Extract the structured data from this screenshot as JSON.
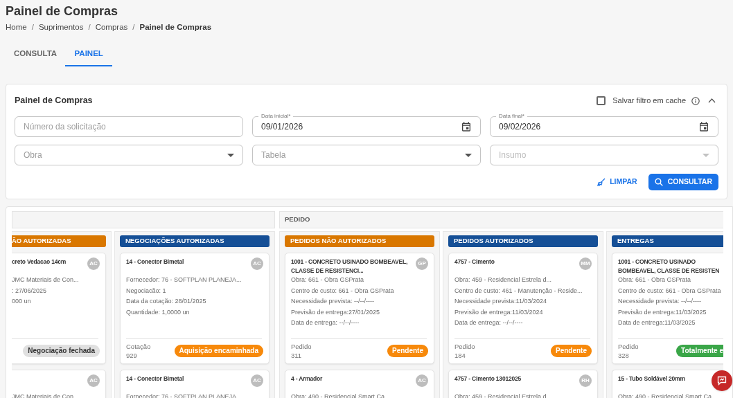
{
  "page": {
    "title": "Painel de Compras",
    "breadcrumbs": [
      "Home",
      "Suprimentos",
      "Compras",
      "Painel de Compras"
    ],
    "separators": [
      "/",
      "/",
      "/"
    ]
  },
  "tabs": [
    {
      "label": "CONSULTA",
      "selected": false
    },
    {
      "label": "PAINEL",
      "selected": true
    }
  ],
  "filter": {
    "title": "Painel de Compras",
    "cache_checkbox": {
      "label": "Salvar filtro em cache",
      "checked": false
    },
    "expanded": true,
    "fields": [
      {
        "kind": "text",
        "placeholder": "Número da solicitação"
      },
      {
        "kind": "date",
        "label": "Data inicial*",
        "value": "09/01/2026"
      },
      {
        "kind": "date",
        "label": "Data final*",
        "value": "09/02/2026"
      },
      {
        "kind": "select",
        "placeholder": "Obra",
        "disabled": false
      },
      {
        "kind": "select",
        "placeholder": "Tabela",
        "disabled": false
      },
      {
        "kind": "select",
        "placeholder": "Insumo",
        "disabled": true
      }
    ],
    "clear_button": "LIMPAR",
    "search_button": "CONSULTAR"
  },
  "board": {
    "groups": [
      {
        "columns": [
          {
            "kind": "cut-left",
            "title": "ÃO AUTORIZADAS",
            "color": "#d97700",
            "cards": [
              {
                "title": "creto Vedacao 14cm",
                "avatar": "AC",
                "lines": [
                  "JMC Materiais de Con...",
                  ": 27/06/2025",
                  "000 un"
                ],
                "status": {
                  "label": "Negociação fechada",
                  "color": "#e0e0e0"
                }
              },
              {
                "avatar": "AC",
                "lines": [
                  "JMC Materiais de Con"
                ]
              }
            ]
          },
          {
            "kind": "full",
            "title": "NEGOCIAÇÕES AUTORIZADAS",
            "color": "#154f96",
            "cards": [
              {
                "title": "14 - Conector Bimetal",
                "avatar": "AC",
                "lines": [
                  "Fornecedor: 76 - SOFTPLAN PLANEJA...",
                  "Negociacão: 1",
                  "Data da cotação: 28/01/2025",
                  "Quantidade: 1,0000 un"
                ],
                "footer_label": "Cotação",
                "footer_value": "929",
                "status": {
                  "label": "Aquisição encaminhada",
                  "color": "#f7890b"
                }
              },
              {
                "title": "14 - Conector Bimetal",
                "avatar": "AC",
                "lines": [
                  "Fornecedor: 76 - SOFTPLAN PLANEJA"
                ]
              }
            ]
          }
        ]
      },
      {
        "title": "PEDIDO",
        "columns": [
          {
            "kind": "full",
            "title": "PEDIDOS NÃO AUTORIZADOS",
            "color": "#d97700",
            "cards": [
              {
                "title": "1001 - CONCRETO USINADO BOMBEAVEL, CLASSE DE RESISTENCI...",
                "avatar": "GP",
                "lines": [
                  "Obra: 661 - Obra GSPrata",
                  "Centro de custo: 661 - Obra GSPrata",
                  "Necessidade prevista: --/--/----",
                  "Previsão de entrega:27/01/2025",
                  "Data de entrega: --/--/----"
                ],
                "footer_label": "Pedido",
                "footer_value": "311",
                "status": {
                  "label": "Pendente",
                  "color": "#f7890b"
                }
              },
              {
                "title": "4 - Armador",
                "avatar": "AC",
                "lines": [
                  "Obra: 490 - Residencial Smart Ca"
                ]
              }
            ]
          },
          {
            "kind": "full",
            "title": "PEDIDOS AUTORIZADOS",
            "color": "#154f96",
            "cards": [
              {
                "title": "4757 - Cimento",
                "avatar": "MM",
                "lines": [
                  "Obra: 459 - Residencial Estrela d...",
                  "Centro de custo: 461 - Manutenção - Reside...",
                  "Necessidade prevista:11/03/2024",
                  "Previsão de entrega:11/03/2024",
                  "Data de entrega: --/--/----"
                ],
                "footer_label": "Pedido",
                "footer_value": "184",
                "status": {
                  "label": "Pendente",
                  "color": "#f7890b"
                }
              },
              {
                "title": "4757 - Cimento 13012025",
                "avatar": "RH",
                "lines": [
                  "Obra: 459 - Residencial Estrela d"
                ]
              }
            ]
          },
          {
            "kind": "cut-right",
            "title": "ENTREGAS",
            "color": "#154f96",
            "cards": [
              {
                "title": "1001 - CONCRETO USINADO BOMBEAVEL, CLASSE DE RESISTEN",
                "lines": [
                  "Obra: 661 - Obra GSPrata",
                  "Centro de custo: 661 - Obra GSPrata",
                  "Necessidade prevista: --/--/----",
                  "Previsão de entrega:11/03/2025",
                  "Data de entrega:11/03/2025"
                ],
                "footer_label": "Pedido",
                "footer_value": "328",
                "status": {
                  "label": "Totalmente e",
                  "color": "#3aa648"
                }
              },
              {
                "title": "15 - Tubo Soldável 20mm",
                "lines": [
                  "Obra: 490 - Residencial Smart Ca"
                ]
              }
            ]
          }
        ]
      }
    ]
  }
}
